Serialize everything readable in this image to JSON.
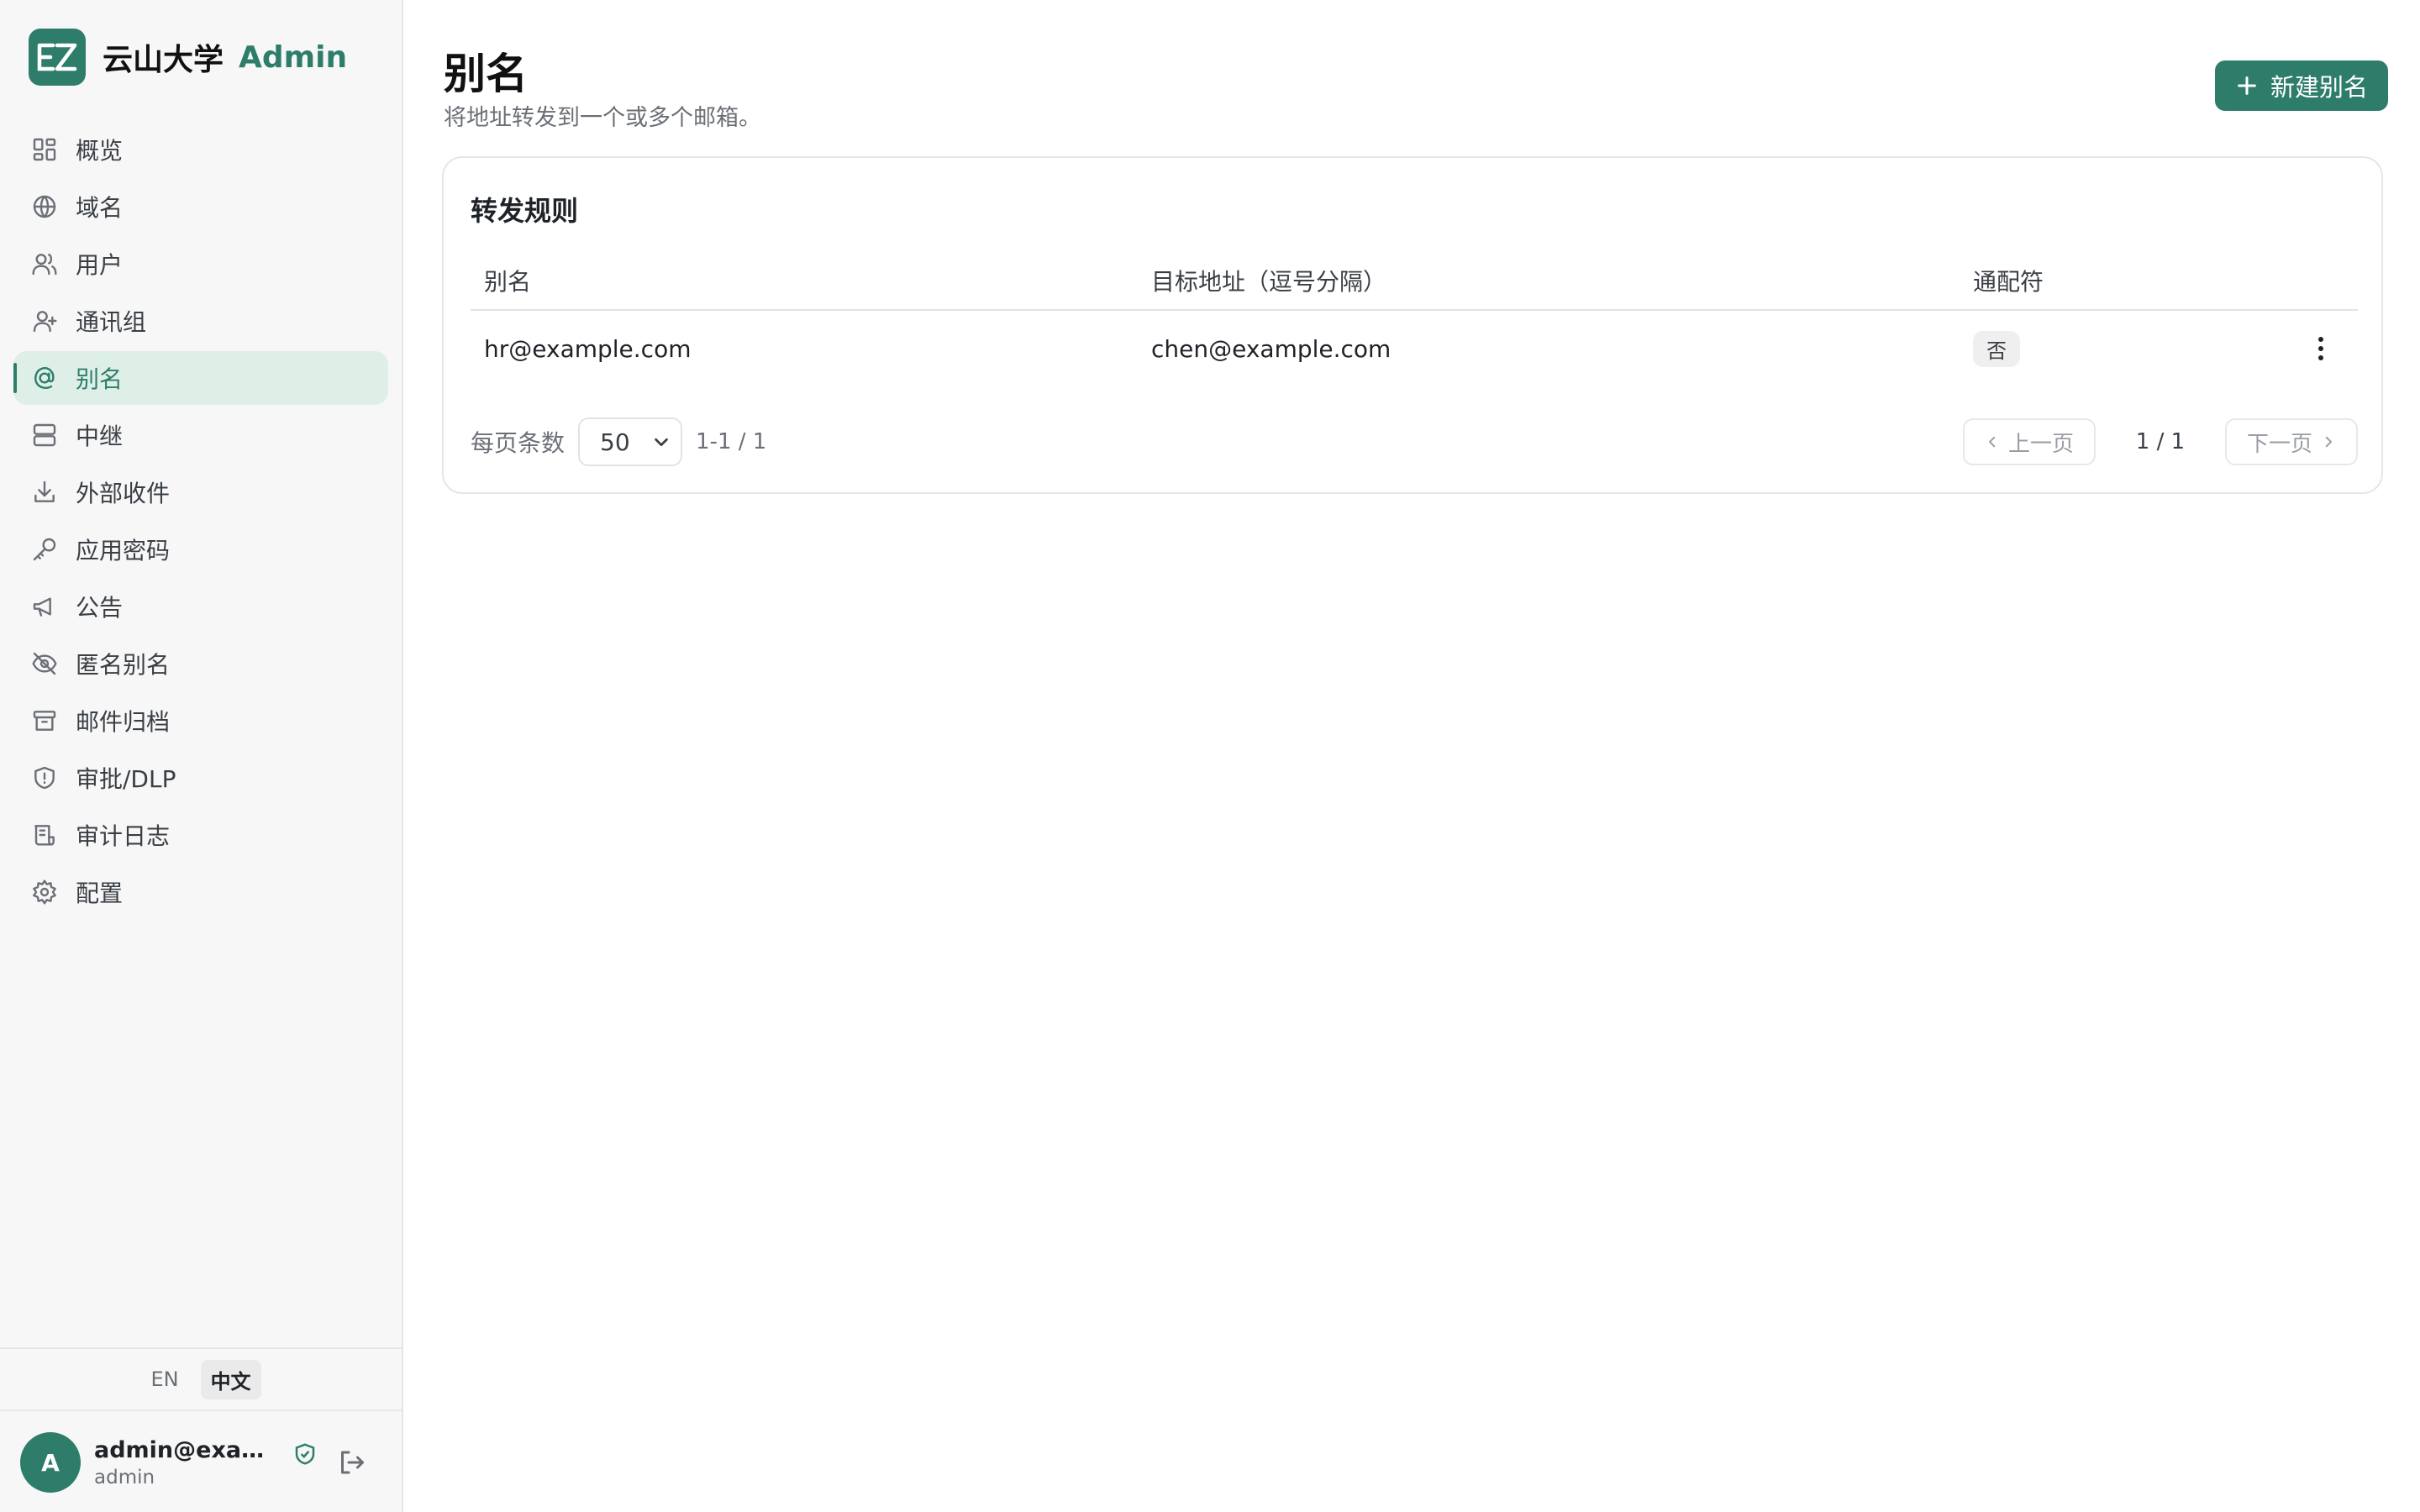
{
  "brand": {
    "name": "云山大学",
    "suffix": "Admin",
    "logo_text": "EZ"
  },
  "sidebar": {
    "items": [
      {
        "label": "概览",
        "icon": "dashboard-icon"
      },
      {
        "label": "域名",
        "icon": "globe-icon"
      },
      {
        "label": "用户",
        "icon": "users-icon"
      },
      {
        "label": "通讯组",
        "icon": "user-group-icon"
      },
      {
        "label": "别名",
        "icon": "at-icon",
        "active": true
      },
      {
        "label": "中继",
        "icon": "server-icon"
      },
      {
        "label": "外部收件",
        "icon": "download-icon"
      },
      {
        "label": "应用密码",
        "icon": "key-icon"
      },
      {
        "label": "公告",
        "icon": "megaphone-icon"
      },
      {
        "label": "匿名别名",
        "icon": "eye-off-icon"
      },
      {
        "label": "邮件归档",
        "icon": "archive-icon"
      },
      {
        "label": "审批/DLP",
        "icon": "shield-icon"
      },
      {
        "label": "审计日志",
        "icon": "scroll-icon"
      },
      {
        "label": "配置",
        "icon": "gear-icon"
      }
    ]
  },
  "language": {
    "en": "EN",
    "zh": "中文",
    "active": "zh"
  },
  "user": {
    "avatar_letter": "A",
    "email": "admin@example.com",
    "role": "admin"
  },
  "page": {
    "title": "别名",
    "subtitle": "将地址转发到一个或多个邮箱。",
    "new_button": "新建别名"
  },
  "card": {
    "title": "转发规则",
    "columns": {
      "alias": "别名",
      "target": "目标地址（逗号分隔）",
      "wildcard": "通配符"
    },
    "rows": [
      {
        "alias": "hr@example.com",
        "target": "chen@example.com",
        "wildcard": "否"
      }
    ]
  },
  "pagination": {
    "per_page_label": "每页条数",
    "per_page_value": "50",
    "range": "1-1 / 1",
    "prev": "上一页",
    "next": "下一页",
    "page_indicator": "1 / 1"
  },
  "colors": {
    "accent": "#2e7d6b",
    "active_bg": "#deefe7",
    "sidebar_bg": "#f7f7f7"
  }
}
